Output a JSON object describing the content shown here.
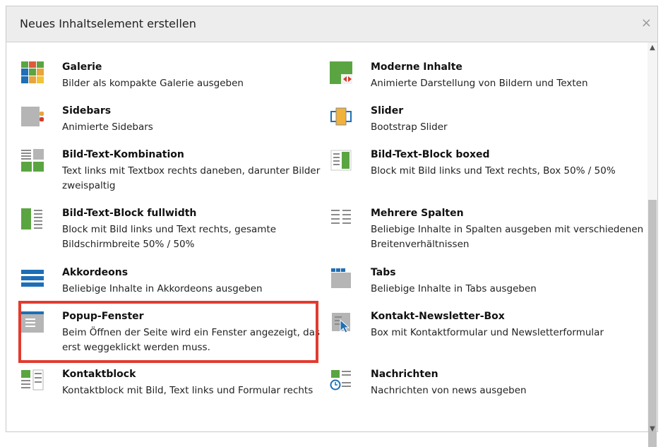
{
  "dialog": {
    "title": "Neues Inhaltselement erstellen",
    "close_label": "×"
  },
  "items": [
    {
      "title": "Galerie",
      "desc": "Bilder als kompakte Galerie ausgeben",
      "icon": "gallery-icon"
    },
    {
      "title": "Moderne Inhalte",
      "desc": "Animierte Darstellung von Bildern und Texten",
      "icon": "modern-content-icon"
    },
    {
      "title": "Sidebars",
      "desc": "Animierte Sidebars",
      "icon": "sidebars-icon"
    },
    {
      "title": "Slider",
      "desc": "Bootstrap Slider",
      "icon": "slider-icon"
    },
    {
      "title": "Bild-Text-Kombination",
      "desc": "Text links mit Textbox rechts daneben, darunter Bilder zweispaltig",
      "icon": "image-text-combination-icon"
    },
    {
      "title": "Bild-Text-Block boxed",
      "desc": "Block mit Bild links und Text rechts, Box 50% / 50%",
      "icon": "image-text-block-boxed-icon"
    },
    {
      "title": "Bild-Text-Block fullwidth",
      "desc": "Block mit Bild links und Text rechts, gesamte Bildschirmbreite 50% / 50%",
      "icon": "image-text-block-fullwidth-icon"
    },
    {
      "title": "Mehrere Spalten",
      "desc": "Beliebige Inhalte in Spalten ausgeben mit verschiedenen Breitenverhältnissen",
      "icon": "columns-icon"
    },
    {
      "title": "Akkordeons",
      "desc": "Beliebige Inhalte in Akkordeons ausgeben",
      "icon": "accordion-icon"
    },
    {
      "title": "Tabs",
      "desc": "Beliebige Inhalte in Tabs ausgeben",
      "icon": "tabs-icon"
    },
    {
      "title": "Popup-Fenster",
      "desc": "Beim Öffnen der Seite wird ein Fenster angezeigt, das erst weggeklickt werden muss.",
      "icon": "popup-icon"
    },
    {
      "title": "Kontakt-Newsletter-Box",
      "desc": "Box mit Kontaktformular und Newsletterformular",
      "icon": "contact-newsletter-icon"
    },
    {
      "title": "Kontaktblock",
      "desc": "Kontaktblock mit Bild, Text links und Formular rechts",
      "icon": "contact-block-icon"
    },
    {
      "title": "Nachrichten",
      "desc": "Nachrichten von news ausgeben",
      "icon": "news-icon"
    }
  ],
  "colors": {
    "highlight": "#e23b2f",
    "green": "#5aa542",
    "blue": "#1e6fb5",
    "orange": "#e8a53c"
  }
}
